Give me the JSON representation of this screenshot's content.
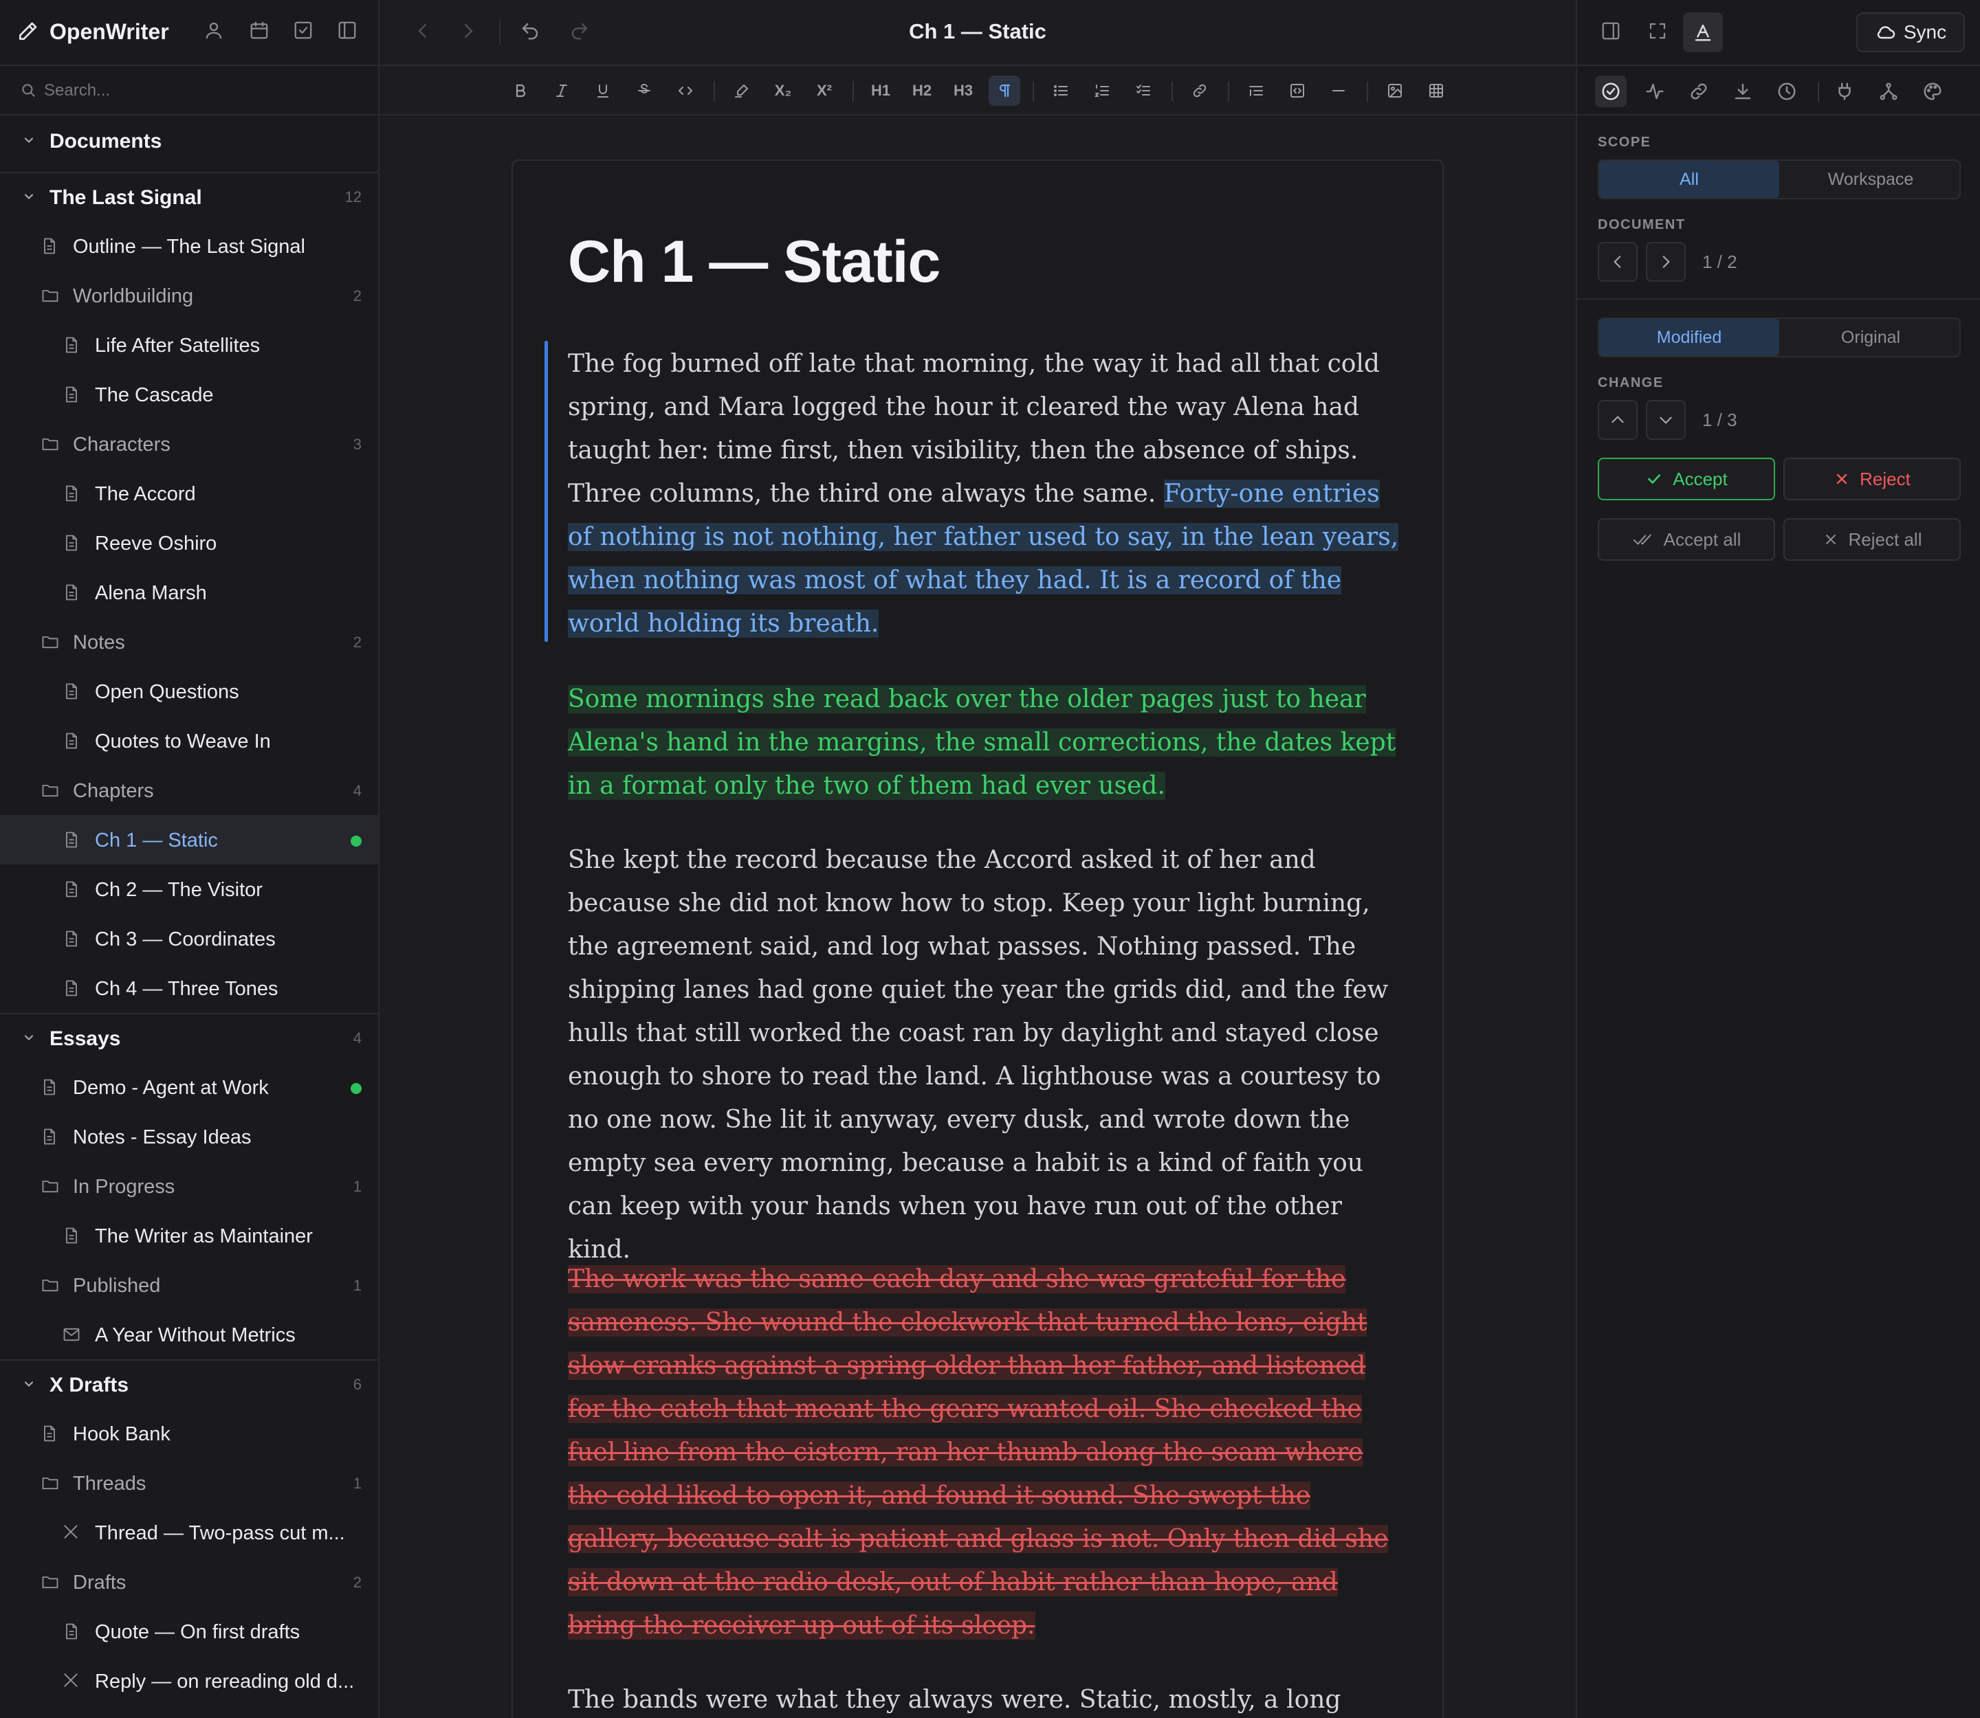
{
  "app": {
    "name": "OpenWriter"
  },
  "search": {
    "placeholder": "Search..."
  },
  "tree": [
    {
      "kind": "section",
      "label": "Documents",
      "count": ""
    },
    {
      "kind": "section",
      "label": "The Last Signal",
      "count": "12"
    },
    {
      "kind": "doc",
      "depth": 1,
      "label": "Outline — The Last Signal"
    },
    {
      "kind": "folder",
      "depth": 1,
      "label": "Worldbuilding",
      "count": "2"
    },
    {
      "kind": "doc",
      "depth": 2,
      "label": "Life After Satellites"
    },
    {
      "kind": "doc",
      "depth": 2,
      "label": "The Cascade"
    },
    {
      "kind": "folder",
      "depth": 1,
      "label": "Characters",
      "count": "3"
    },
    {
      "kind": "doc",
      "depth": 2,
      "label": "The Accord"
    },
    {
      "kind": "doc",
      "depth": 2,
      "label": "Reeve Oshiro"
    },
    {
      "kind": "doc",
      "depth": 2,
      "label": "Alena Marsh"
    },
    {
      "kind": "folder",
      "depth": 1,
      "label": "Notes",
      "count": "2"
    },
    {
      "kind": "doc",
      "depth": 2,
      "label": "Open Questions"
    },
    {
      "kind": "doc",
      "depth": 2,
      "label": "Quotes to Weave In"
    },
    {
      "kind": "folder",
      "depth": 1,
      "label": "Chapters",
      "count": "4"
    },
    {
      "kind": "doc",
      "depth": 2,
      "label": "Ch 1 — Static",
      "active": true,
      "dot": true
    },
    {
      "kind": "doc",
      "depth": 2,
      "label": "Ch 2 — The Visitor"
    },
    {
      "kind": "doc",
      "depth": 2,
      "label": "Ch 3 — Coordinates"
    },
    {
      "kind": "doc",
      "depth": 2,
      "label": "Ch 4 — Three Tones"
    },
    {
      "kind": "section",
      "label": "Essays",
      "count": "4"
    },
    {
      "kind": "doc",
      "depth": 1,
      "label": "Demo - Agent at Work",
      "dot": true
    },
    {
      "kind": "doc",
      "depth": 1,
      "label": "Notes - Essay Ideas"
    },
    {
      "kind": "folder",
      "depth": 1,
      "label": "In Progress",
      "count": "1"
    },
    {
      "kind": "doc",
      "depth": 2,
      "label": "The Writer as Maintainer"
    },
    {
      "kind": "folder",
      "depth": 1,
      "label": "Published",
      "count": "1"
    },
    {
      "kind": "mail",
      "depth": 2,
      "label": "A Year Without Metrics"
    },
    {
      "kind": "section",
      "label": "X Drafts",
      "count": "6"
    },
    {
      "kind": "doc",
      "depth": 1,
      "label": "Hook Bank"
    },
    {
      "kind": "folder",
      "depth": 1,
      "label": "Threads",
      "count": "1"
    },
    {
      "kind": "x",
      "depth": 2,
      "label": "Thread — Two-pass cut m..."
    },
    {
      "kind": "folder",
      "depth": 1,
      "label": "Drafts",
      "count": "2"
    },
    {
      "kind": "doc",
      "depth": 2,
      "label": "Quote — On first drafts"
    },
    {
      "kind": "x",
      "depth": 2,
      "label": "Reply — on rereading old d..."
    }
  ],
  "editor": {
    "doc_title": "Ch 1 — Static",
    "heading": "Ch 1 — Static",
    "p1_plain": "The fog burned off late that morning, the way it had all that cold spring, and Mara logged the hour it cleared the way Alena had taught her: time first, then visibility, then the absence of ships. Three columns, the third one always the same. ",
    "p1_selected": "Forty-one entries of nothing is not nothing, her father used to say, in the lean years, when nothing was most of what they had. It is a record of the world holding its breath.",
    "p2_added": "Some mornings she read back over the older pages just to hear Alena's hand in the margins, the small corrections, the dates kept in a format only the two of them had ever used.",
    "p3": "She kept the record because the Accord asked it of her and because she did not know how to stop. Keep your light burning, the agreement said, and log what passes. Nothing passed. The shipping lanes had gone quiet the year the grids did, and the few hulls that still worked the coast ran by daylight and stayed close enough to shore to read the land. A lighthouse was a courtesy to no one now. She lit it anyway, every dusk, and wrote down the empty sea every morning, because a habit is a kind of faith you can keep with your hands when you have run out of the other kind.",
    "p4_removed": "The work was the same each day and she was grateful for the sameness. She wound the clockwork that turned the lens, eight slow cranks against a spring older than her father, and listened for the catch that meant the gears wanted oil. She checked the fuel line from the cistern, ran her thumb along the seam where the cold liked to open it, and found it sound. She swept the gallery, because salt is patient and glass is not. Only then did she sit down at the radio desk, out of habit rather than hope, and bring the receiver up out of its sleep.",
    "p5": "The bands were what they always were. Static, mostly, a long grey"
  },
  "toolbar": {
    "h1": "H1",
    "h2": "H2",
    "h3": "H3",
    "sub": "X₂",
    "sup": "X²"
  },
  "review": {
    "sync_label": "Sync",
    "scope_caption": "SCOPE",
    "scope_all": "All",
    "scope_workspace": "Workspace",
    "document_caption": "DOCUMENT",
    "document_page": "1 / 2",
    "view_modified": "Modified",
    "view_original": "Original",
    "change_caption": "CHANGE",
    "change_page": "1 / 3",
    "accept": "Accept",
    "reject": "Reject",
    "accept_all": "Accept all",
    "reject_all": "Reject all"
  },
  "colors": {
    "accent": "#3c7fe0",
    "added": "#3ecf6a",
    "removed": "#e0575a",
    "unsaved_dot": "#2ec25b"
  }
}
